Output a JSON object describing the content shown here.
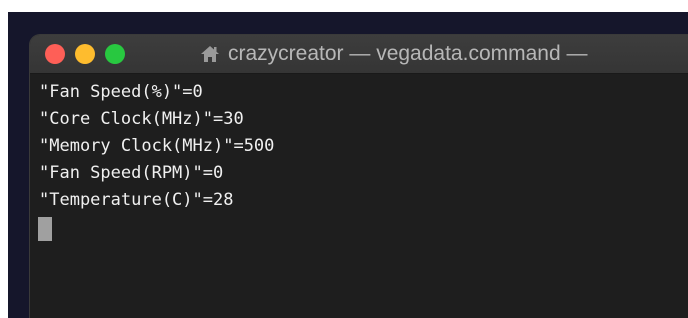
{
  "window": {
    "title": "crazycreator — vegadata.command —",
    "title_icon": "home-icon"
  },
  "terminal": {
    "lines": [
      "\"Fan Speed(%)\"=0",
      "\"Core Clock(MHz)\"=30",
      "\"Memory Clock(MHz)\"=500",
      "\"Fan Speed(RPM)\"=0",
      "\"Temperature(C)\"=28"
    ]
  },
  "colors": {
    "close": "#fe5f57",
    "minimize": "#febc2e",
    "zoom": "#28c840",
    "background": "#1e1e1e",
    "text": "#f0f0f0"
  }
}
